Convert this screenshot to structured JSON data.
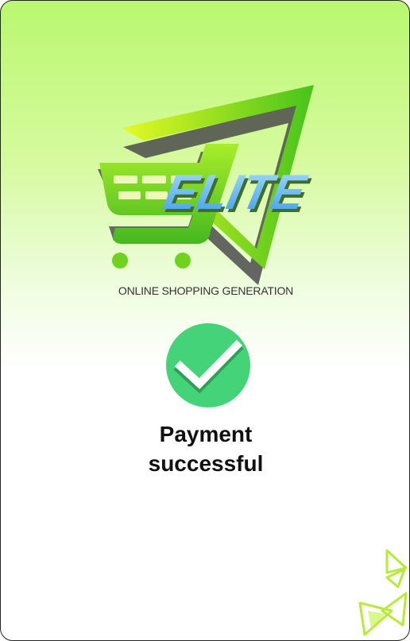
{
  "logo": {
    "brand": "ELITE",
    "tagline": "ONLINE SHOPPING GENERATION"
  },
  "status": {
    "icon": "check-circle-icon",
    "color": "#44d378",
    "line1": "Payment",
    "line2": "successful"
  },
  "colors": {
    "accent_green": "#7ed321",
    "brand_blue": "#4fb0f0",
    "background_top": "#b9f86f"
  }
}
